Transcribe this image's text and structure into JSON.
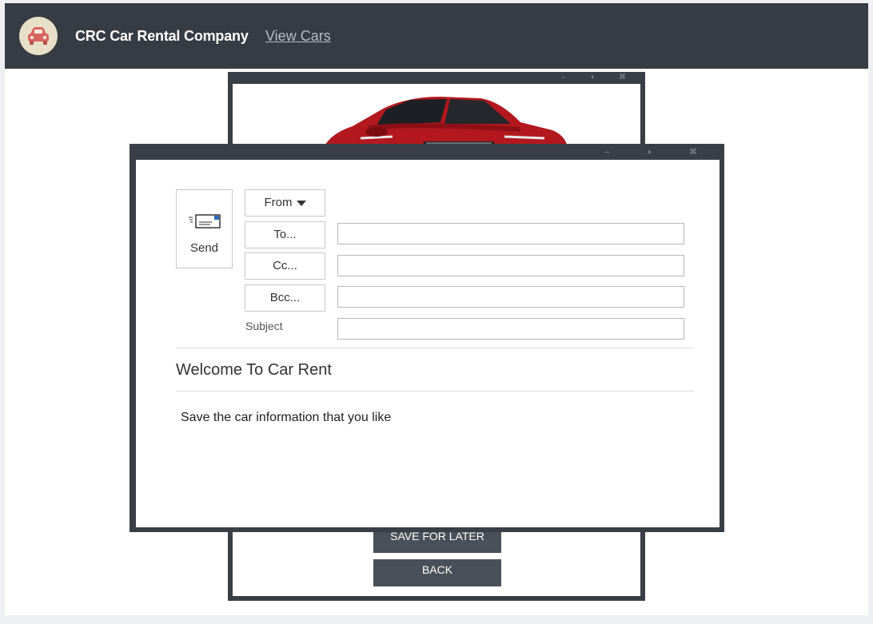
{
  "header": {
    "brand": "CRC Car Rental Company",
    "nav_link": "View Cars",
    "logo_icon": "car-icon",
    "bg_color": "#363b44"
  },
  "car_window": {
    "window_icons": "– ◖ ⌘",
    "save_button": "SAVE FOR LATER",
    "back_button": "BACK"
  },
  "mail_window": {
    "window_icons": "– ◖ ⌘",
    "send": {
      "label": "Send",
      "icon": "envelope-icon"
    },
    "from_label": "From",
    "to_label": "To...",
    "cc_label": "Cc...",
    "bcc_label": "Bcc...",
    "subject_label": "Subject",
    "to_value": "",
    "cc_value": "",
    "bcc_value": "",
    "subject_value": "",
    "subject_display": "Welcome To Car Rent",
    "body": "Save the car information that you like"
  }
}
